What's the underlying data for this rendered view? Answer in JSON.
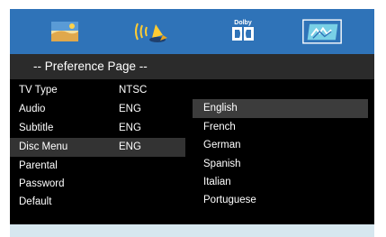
{
  "colors": {
    "top_bar": "#2f73b8",
    "header_bar": "#2b2b2b",
    "menu_panel": "#000000",
    "highlight_row": "#333333",
    "selected_option": "#3c3c3c",
    "footer_bar": "#d6e7ef"
  },
  "top_icons": [
    {
      "name": "picture-setup-icon",
      "selected": false
    },
    {
      "name": "audio-speaker-icon",
      "selected": false
    },
    {
      "name": "dolby-icon",
      "label": "Dolby",
      "selected": false
    },
    {
      "name": "preference-icon",
      "selected": true
    }
  ],
  "header": {
    "title": "-- Preference Page --"
  },
  "menu": {
    "items": [
      {
        "label": "TV Type",
        "value": "NTSC"
      },
      {
        "label": "Audio",
        "value": "ENG"
      },
      {
        "label": "Subtitle",
        "value": "ENG"
      },
      {
        "label": "Disc Menu",
        "value": "ENG",
        "highlighted": true
      },
      {
        "label": "Parental",
        "value": ""
      },
      {
        "label": "Password",
        "value": ""
      },
      {
        "label": "Default",
        "value": ""
      }
    ]
  },
  "options": {
    "items": [
      "English",
      "French",
      "German",
      "Spanish",
      "Italian",
      "Portuguese"
    ],
    "selected": "English"
  }
}
